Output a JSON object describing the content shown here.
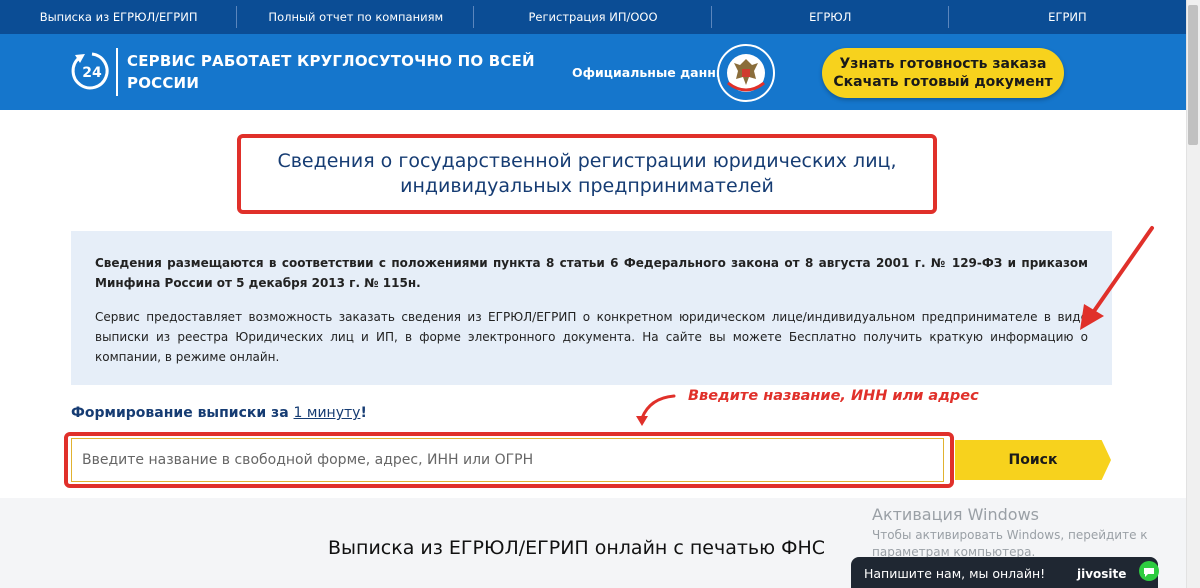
{
  "topnav": {
    "items": [
      "Выписка из ЕГРЮЛ/ЕГРИП",
      "Полный отчет по компаниям",
      "Регистрация ИП/ООО",
      "ЕГРЮЛ",
      "ЕГРИП"
    ]
  },
  "header": {
    "clock_badge": "24",
    "slogan": "СЕРВИС РАБОТАЕТ КРУГЛОСУТОЧНО ПО ВСЕЙ РОССИИ",
    "official_label": "Официальные данные",
    "order_button": {
      "line1": "Узнать готовность заказа",
      "line2": "Скачать готовый документ"
    }
  },
  "main": {
    "title": "Сведения о государственной регистрации юридических лиц, индивидуальных предпринимателей",
    "info_bold": "Сведения размещаются в соответствии с положениями пункта 8 статьи 6 Федерального закона от 8 августа 2001 г. № 129-ФЗ и приказом Минфина России от 5 декабря 2013 г. № 115н.",
    "info_text": "Сервис предоставляет возможность заказать сведения из ЕГРЮЛ/ЕГРИП о конкретном юридическом лице/индивидуальном предпринимателе в виде выписки из реестра Юридических лиц и ИП, в форме электронного документа. На сайте вы можете Бесплатно получить краткую информацию о компании, в режиме онлайн.",
    "formation_prefix": "Формирование выписки за ",
    "formation_link": "1 минуту",
    "formation_suffix": "!",
    "hint": "Введите название, ИНН или адрес",
    "search_placeholder": "Введите название в свободной форме, адрес, ИНН или ОГРН",
    "search_button": "Поиск"
  },
  "bottom": {
    "heading": "Выписка из ЕГРЮЛ/ЕГРИП онлайн с печатью ФНС"
  },
  "watermark": {
    "title": "Активация Windows",
    "text": "Чтобы активировать Windows, перейдите к параметрам компьютера."
  },
  "chat": {
    "label": "Напишите нам, мы онлайн!",
    "brand": "jivosite"
  },
  "colors": {
    "nav": "#0b4d95",
    "header": "#1576cc",
    "accent_yellow": "#f7d21d",
    "highlight_red": "#e0302a",
    "title_blue": "#163c73"
  }
}
